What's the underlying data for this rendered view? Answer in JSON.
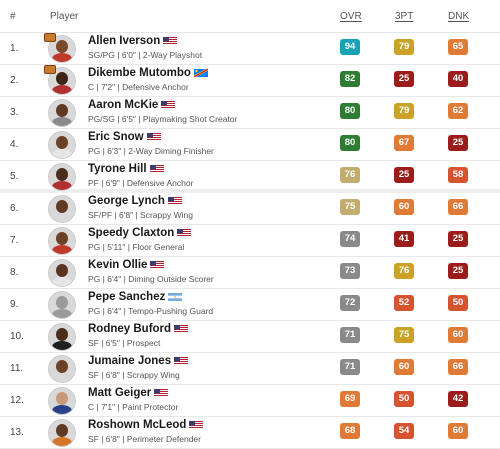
{
  "header": {
    "rank": "#",
    "player": "Player",
    "ovr": "OVR",
    "three_pt": "3PT",
    "dunk": "DNK"
  },
  "colors": {
    "dark_green": "#2e7d32",
    "green": "#4caf50",
    "teal": "#17a2b8",
    "gold": "#c9a227",
    "tan": "#c2ad6f",
    "gray": "#8a8a8a",
    "orange": "#e07a37",
    "red_orange": "#d6532f",
    "dark_red": "#9c1c1c"
  },
  "players": [
    {
      "rank": "1.",
      "name": "Allen Iverson",
      "flag": "us",
      "info": "SG/PG | 6'0\" | 2-Way Playshot",
      "ovr": "94",
      "three_pt": "79",
      "dunk": "65",
      "skin": "#7a4a2c",
      "jersey": "#c0392b",
      "team_logo": true
    },
    {
      "rank": "2.",
      "name": "Dikembe Mutombo",
      "flag": "cd",
      "info": "C | 7'2\" | Defensive Anchor",
      "ovr": "82",
      "three_pt": "25",
      "dunk": "40",
      "skin": "#3e2418",
      "jersey": "#b03030",
      "team_logo": true
    },
    {
      "rank": "3.",
      "name": "Aaron McKie",
      "flag": "us",
      "info": "PG/SG | 6'5\" | Playmaking Shot Creator",
      "ovr": "80",
      "three_pt": "79",
      "dunk": "62",
      "skin": "#5e3a24",
      "jersey": "#8a8a8a",
      "team_logo": false
    },
    {
      "rank": "4.",
      "name": "Eric Snow",
      "flag": "us",
      "info": "PG | 6'3\" | 2-Way Diming Finisher",
      "ovr": "80",
      "three_pt": "67",
      "dunk": "25",
      "skin": "#6b4128",
      "jersey": "#e6e6e6",
      "team_logo": false
    },
    {
      "rank": "5.",
      "name": "Tyrone Hill",
      "flag": "us",
      "info": "PF | 6'9\" | Defensive Anchor",
      "ovr": "76",
      "three_pt": "25",
      "dunk": "58",
      "skin": "#4a2c1c",
      "jersey": "#b03030",
      "team_logo": false,
      "gap": true
    },
    {
      "rank": "6.",
      "name": "George Lynch",
      "flag": "us",
      "info": "SF/PF | 6'8\" | Scrappy Wing",
      "ovr": "75",
      "three_pt": "60",
      "dunk": "66",
      "skin": "#5e3a24",
      "jersey": "#d9d9d9",
      "team_logo": false
    },
    {
      "rank": "7.",
      "name": "Speedy Claxton",
      "flag": "us",
      "info": "PG | 5'11\" | Floor General",
      "ovr": "74",
      "three_pt": "41",
      "dunk": "25",
      "skin": "#6b4128",
      "jersey": "#c0392b",
      "team_logo": false
    },
    {
      "rank": "8.",
      "name": "Kevin Ollie",
      "flag": "us",
      "info": "PG | 6'4\" | Diming Outside Scorer",
      "ovr": "73",
      "three_pt": "76",
      "dunk": "25",
      "skin": "#5a3622",
      "jersey": "#e6e6e6",
      "team_logo": false
    },
    {
      "rank": "9.",
      "name": "Pepe Sanchez",
      "flag": "ar",
      "info": "PG | 6'4\" | Tempo-Pushing Guard",
      "ovr": "72",
      "three_pt": "52",
      "dunk": "50",
      "skin": "#9a9a9a",
      "jersey": "#9a9a9a",
      "team_logo": false,
      "silhouette": true
    },
    {
      "rank": "10.",
      "name": "Rodney Buford",
      "flag": "us",
      "info": "SF | 6'5\" | Prospect",
      "ovr": "71",
      "three_pt": "75",
      "dunk": "60",
      "skin": "#4a2c1c",
      "jersey": "#1f1f1f",
      "team_logo": false
    },
    {
      "rank": "11.",
      "name": "Jumaine Jones",
      "flag": "us",
      "info": "SF | 6'8\" | Scrappy Wing",
      "ovr": "71",
      "three_pt": "60",
      "dunk": "66",
      "skin": "#6b4128",
      "jersey": "#d9d9d9",
      "team_logo": false
    },
    {
      "rank": "12.",
      "name": "Matt Geiger",
      "flag": "us",
      "info": "C | 7'1\" | Paint Protector",
      "ovr": "69",
      "three_pt": "50",
      "dunk": "42",
      "skin": "#c99a78",
      "jersey": "#2a3f8a",
      "team_logo": false
    },
    {
      "rank": "13.",
      "name": "Roshown McLeod",
      "flag": "us",
      "info": "SF | 6'8\" | Perimeter Defender",
      "ovr": "68",
      "three_pt": "54",
      "dunk": "60",
      "skin": "#5e3a24",
      "jersey": "#d4752a",
      "team_logo": false
    }
  ]
}
